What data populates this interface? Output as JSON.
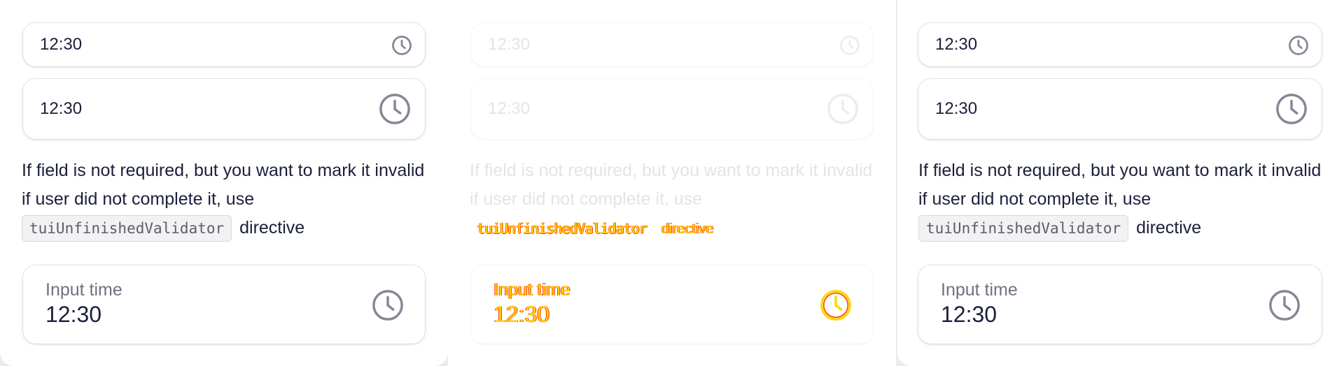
{
  "columns": [
    {
      "state": "default",
      "small_value": "12:30",
      "medium_value": "12:30",
      "hint_text": "If field is not required, but you want to mark it invalid if user did not complete it, use",
      "hint_code": "tuiUnfinishedValidator",
      "hint_suffix": "directive",
      "large_label": "Input time",
      "large_value": "12:30"
    },
    {
      "state": "disabled",
      "small_value": "12:30",
      "medium_value": "12:30",
      "hint_text": "If field is not required, but you want to mark it invalid if user did not complete it, use",
      "hint_code": "tuiUnfinishedValidator",
      "hint_suffix": "directive",
      "large_label": "Input time",
      "large_value": "12:30"
    },
    {
      "state": "default",
      "small_value": "12:30",
      "medium_value": "12:30",
      "hint_text": "If field is not required, but you want to mark it invalid if user did not complete it, use",
      "hint_code": "tuiUnfinishedValidator",
      "hint_suffix": "directive",
      "large_label": "Input time",
      "large_value": "12:30"
    }
  ],
  "icons": {
    "clock": "clock-icon"
  },
  "colors": {
    "text": "#1b1f3b",
    "icon": "#858797",
    "label": "#6f7180",
    "disabled": "#e4e4e8",
    "glitch_yellow": "#ffd400",
    "glitch_red": "#ff3a00"
  }
}
